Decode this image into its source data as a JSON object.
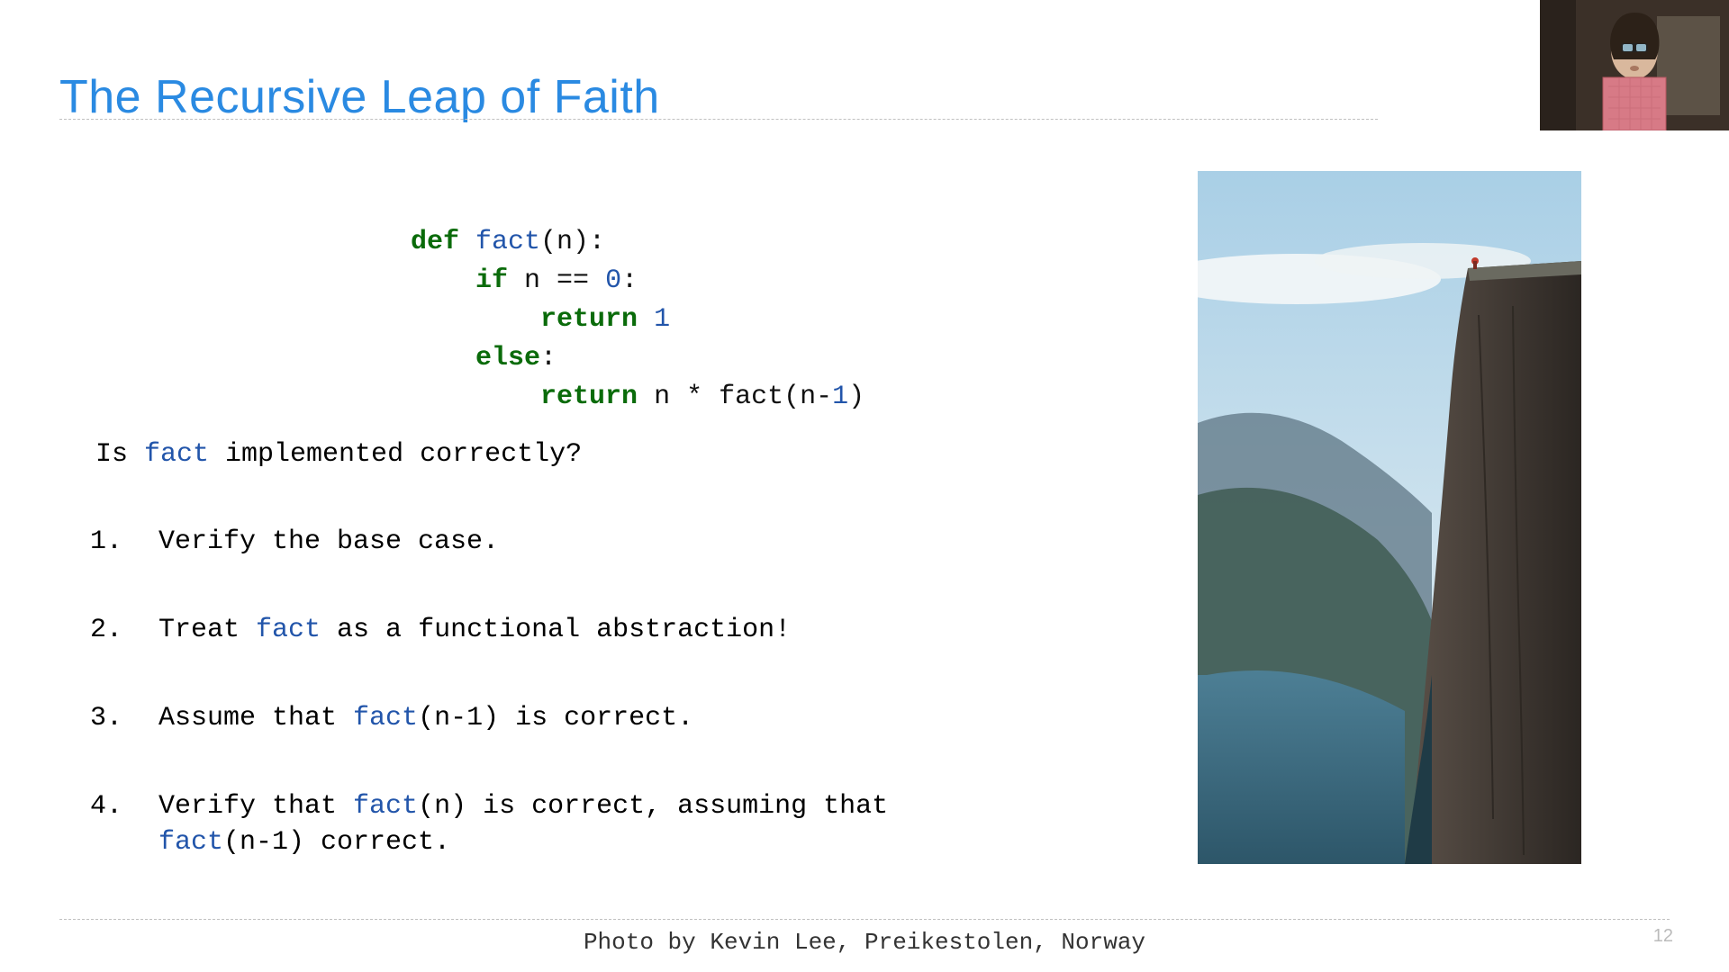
{
  "title": "The Recursive Leap of Faith",
  "code": {
    "l1a": "def",
    "l1b": " ",
    "l1c": "fact",
    "l1d": "(n):",
    "l2a": "    ",
    "l2b": "if",
    "l2c": " n == ",
    "l2d": "0",
    "l2e": ":",
    "l3a": "        ",
    "l3b": "return",
    "l3c": " ",
    "l3d": "1",
    "l4a": "    ",
    "l4b": "else",
    "l4c": ":",
    "l5a": "        ",
    "l5b": "return",
    "l5c": " n * fact(n-",
    "l5d": "1",
    "l5e": ")"
  },
  "question": {
    "pre": "Is ",
    "fn": "fact",
    "post": " implemented correctly?"
  },
  "items": {
    "i1": {
      "num": "1.",
      "t1": "Verify the base case."
    },
    "i2": {
      "num": "2.",
      "t1": "Treat ",
      "fn": "fact",
      "t2": " as a functional abstraction!"
    },
    "i3": {
      "num": "3.",
      "t1": "Assume that ",
      "fn": "fact",
      "t2": "(n-1) is correct."
    },
    "i4": {
      "num": "4.",
      "t1": "Verify that ",
      "fn1": "fact",
      "t2": "(n) is correct, assuming that\n",
      "fn2": "fact",
      "t3": "(n-1) correct."
    }
  },
  "caption": "Photo by Kevin Lee, Preikestolen, Norway",
  "slide_number": "12"
}
